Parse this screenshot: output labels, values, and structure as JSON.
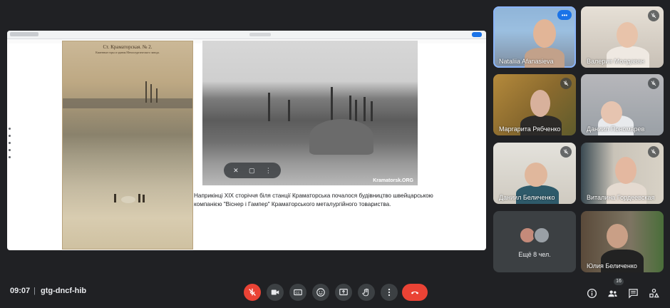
{
  "presentation": {
    "left_photo": {
      "caption_line1": "Ст. Краматорская. № 2.",
      "caption_line2": "Каменные горы и здания Металлургического завода."
    },
    "right_photo": {
      "watermark": "Kramatorsk.ORG"
    },
    "slide_text_line1": "Наприкінці XIX сторіччя біля станції Краматорська почалося будівництво швейцарською",
    "slide_text_line2": "компанією \"Віснер і Гампер\" Краматорського металургійного товариства."
  },
  "participants": [
    {
      "name": "Nataliia Afanasieva",
      "muted": false,
      "active": true
    },
    {
      "name": "Валерия Молдаван",
      "muted": true
    },
    {
      "name": "Маргарита Рябченко",
      "muted": true
    },
    {
      "name": "Даниил Пономарев",
      "muted": true
    },
    {
      "name": "Даниил Беличенко",
      "muted": true
    },
    {
      "name": "Виталина Гордеевская",
      "muted": true
    },
    {
      "name": "Юлия Беличенко",
      "muted": false
    }
  ],
  "more_participants": {
    "label": "Ещё 8 чел."
  },
  "meeting": {
    "time": "09:07",
    "separator": "|",
    "code": "gtg-dncf-hib"
  },
  "toolbar": {
    "participants_count": "16"
  },
  "colors": {
    "background": "#202124",
    "control": "#3c4043",
    "danger": "#ea4335",
    "accent": "#8ab4f8"
  }
}
